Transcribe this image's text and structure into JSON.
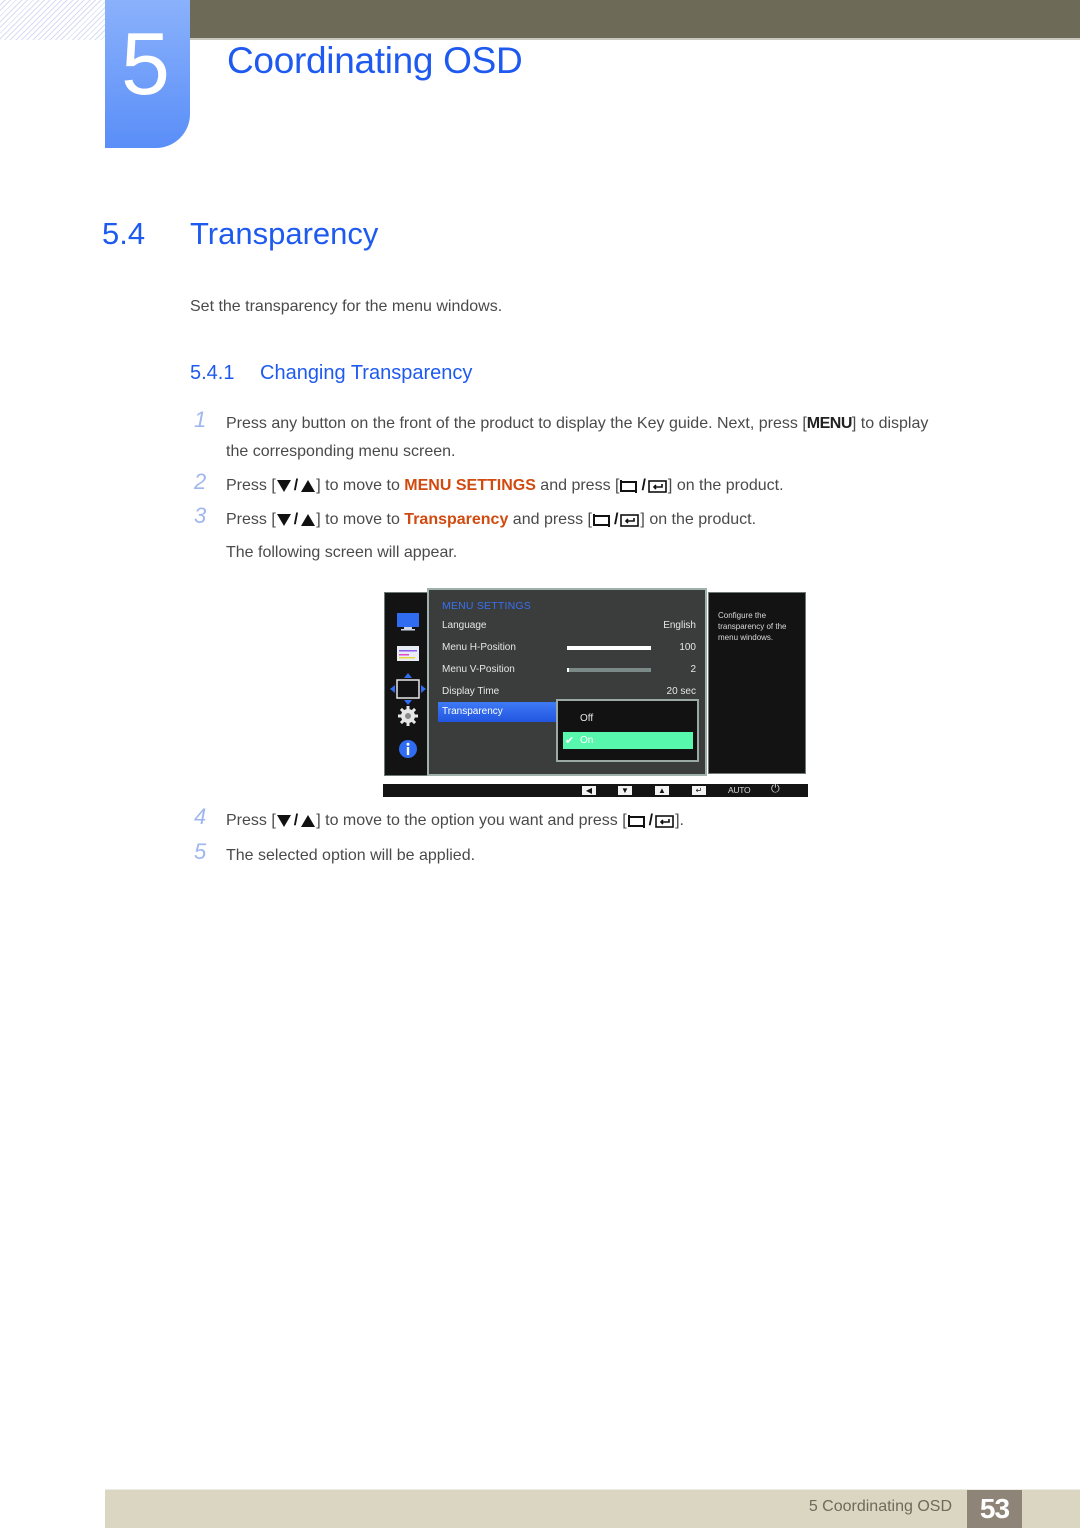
{
  "header": {
    "chapter_number": "5",
    "chapter_title": "Coordinating OSD"
  },
  "section": {
    "number": "5.4",
    "title": "Transparency",
    "intro": "Set the transparency for the menu windows."
  },
  "subsection": {
    "number": "5.4.1",
    "title": "Changing Transparency"
  },
  "steps": [
    {
      "number": "1",
      "line1_a": "Press any button on the front of the product to display the Key guide. Next, press [",
      "key": "MENU",
      "line1_b": "] to display",
      "line2": "the corresponding menu screen."
    },
    {
      "number": "2",
      "a": "Press [",
      "b": "] to move to ",
      "highlight": "MENU SETTINGS",
      "c": " and press [",
      "d": "] on the product."
    },
    {
      "number": "3",
      "a": "Press [",
      "b": "] to move to ",
      "highlight": "Transparency",
      "c": " and press [",
      "d": "] on the product.",
      "line2": "The following screen will appear."
    },
    {
      "number": "4",
      "a": "Press [",
      "b": "] to move to the option you want and press [",
      "d": "]."
    },
    {
      "number": "5",
      "text": "The selected option will be applied."
    }
  ],
  "osd": {
    "sidebar_icons": [
      "monitor-icon",
      "color-adjust-icon",
      "position-arrows-icon",
      "settings-gear-icon",
      "info-icon"
    ],
    "heading": "MENU SETTINGS",
    "rows": [
      {
        "label": "Language",
        "value": "English"
      },
      {
        "label": "Menu H-Position",
        "value": "100",
        "level": 1.0
      },
      {
        "label": "Menu V-Position",
        "value": "2",
        "level": 0.02
      },
      {
        "label": "Display Time",
        "value": "20 sec"
      }
    ],
    "selected_item": "Transparency",
    "options": [
      {
        "label": "Off",
        "selected": false
      },
      {
        "label": "On",
        "selected": true
      }
    ],
    "help_text": "Configure the transparency of the menu windows.",
    "keybar": {
      "keys": [
        "left-arrow-key",
        "down-arrow-key",
        "up-arrow-key",
        "enter-key"
      ],
      "auto_label": "AUTO",
      "power": "power-icon"
    },
    "colors": {
      "heading": "#3a6ff0",
      "selected_bg": "#2f68ee",
      "option_selected_bg": "#57f7ad"
    }
  },
  "footer": {
    "text": "5 Coordinating OSD",
    "page": "53"
  },
  "colors": {
    "accent_blue": "#1e5af0",
    "highlight_orange": "#d14a0f",
    "topbar": "#6d6b58",
    "footer_bg": "#dbd6c2",
    "page_box": "#8f8478"
  }
}
